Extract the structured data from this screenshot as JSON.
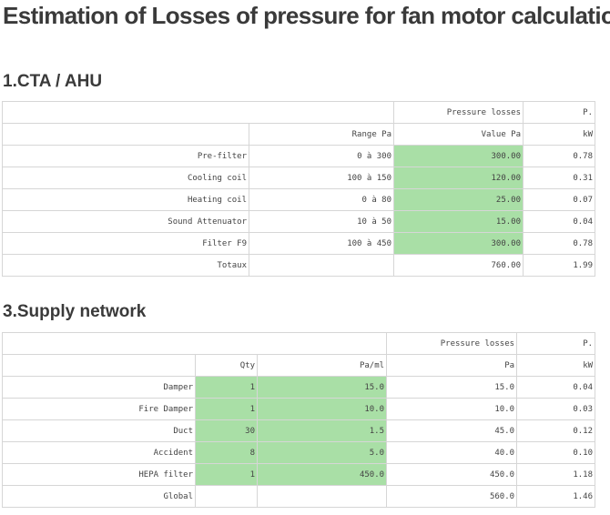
{
  "page_title": "Estimation of Losses of pressure for fan motor calculation",
  "section1": {
    "title": "1.CTA / AHU",
    "group_header": "Pressure losses",
    "power_header": "P.",
    "range_header": "Range Pa",
    "value_header": "Value Pa",
    "unit_header": "kW",
    "rows": [
      {
        "name": "Pre-filter",
        "range": "0 à 300",
        "value": "300.00",
        "kw": "0.78"
      },
      {
        "name": "Cooling coil",
        "range": "100 à 150",
        "value": "120.00",
        "kw": "0.31"
      },
      {
        "name": "Heating coil",
        "range": "0 à 80",
        "value": "25.00",
        "kw": "0.07"
      },
      {
        "name": "Sound Attenuator",
        "range": "10 à 50",
        "value": "15.00",
        "kw": "0.04"
      },
      {
        "name": "Filter F9",
        "range": "100 à 450",
        "value": "300.00",
        "kw": "0.78"
      }
    ],
    "total": {
      "name": "Totaux",
      "value": "760.00",
      "kw": "1.99"
    }
  },
  "section2": {
    "title": "3.Supply network",
    "group_header": "Pressure losses",
    "power_header": "P.",
    "qty_header": "Qty",
    "paml_header": "Pa/ml",
    "pa_header": "Pa",
    "unit_header": "kW",
    "rows": [
      {
        "name": "Damper",
        "qty": "1",
        "paml": "15.0",
        "pa": "15.0",
        "kw": "0.04"
      },
      {
        "name": "Fire Damper",
        "qty": "1",
        "paml": "10.0",
        "pa": "10.0",
        "kw": "0.03"
      },
      {
        "name": "Duct",
        "qty": "30",
        "paml": "1.5",
        "pa": "45.0",
        "kw": "0.12"
      },
      {
        "name": "Accident",
        "qty": "8",
        "paml": "5.0",
        "pa": "40.0",
        "kw": "0.10"
      },
      {
        "name": "HEPA filter",
        "qty": "1",
        "paml": "450.0",
        "pa": "450.0",
        "kw": "1.18"
      }
    ],
    "total": {
      "name": "Global",
      "pa": "560.0",
      "kw": "1.46"
    }
  },
  "colors": {
    "highlight": "#a9dfa6",
    "border": "#d6d6d6",
    "text": "#444444"
  }
}
